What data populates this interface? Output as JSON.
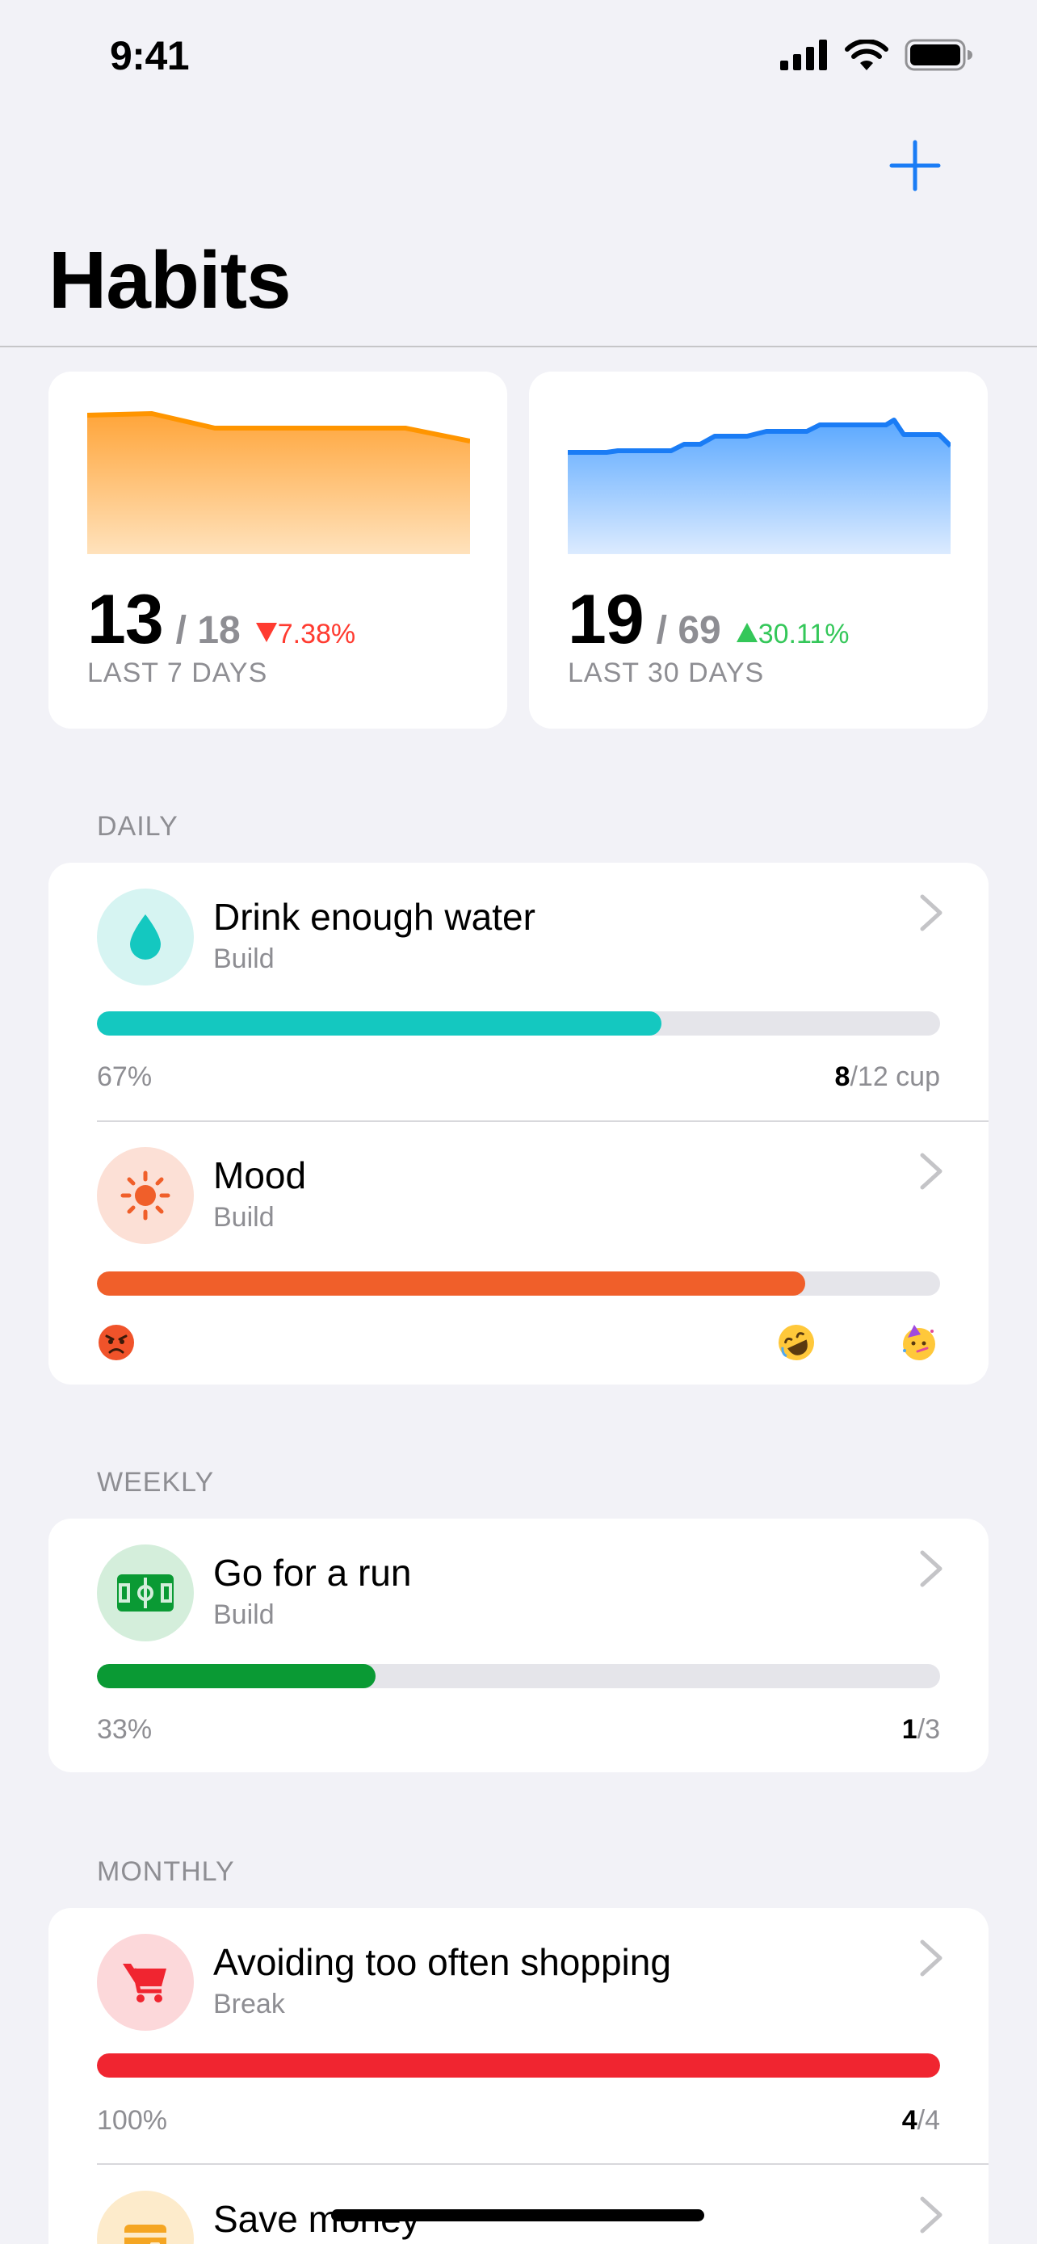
{
  "status_bar": {
    "time": "9:41"
  },
  "nav": {
    "title": "Habits"
  },
  "stats": [
    {
      "value": "13",
      "total": "/ 18",
      "change": "7.38%",
      "direction": "down",
      "label": "LAST 7 DAYS",
      "color": "#FF9500"
    },
    {
      "value": "19",
      "total": "/ 69",
      "change": "30.11%",
      "direction": "up",
      "label": "LAST 30 DAYS",
      "color": "#1A7CF5"
    }
  ],
  "sections": {
    "daily": {
      "header": "DAILY",
      "habits": [
        {
          "name": "Drink enough water",
          "type": "Build",
          "percent": "67%",
          "progress": 0.67,
          "count_done": "8",
          "count_rest": "/12 cup",
          "color": "#14C8C0",
          "icon": "water-drop-icon"
        },
        {
          "name": "Mood",
          "type": "Build",
          "progress": 0.84,
          "color": "#F05F2A",
          "icon": "sun-icon",
          "emojis": [
            "angry-face-emoji",
            "rolling-laughing-face-emoji",
            "partying-face-emoji"
          ]
        }
      ]
    },
    "weekly": {
      "header": "WEEKLY",
      "habits": [
        {
          "name": "Go for a run",
          "type": "Build",
          "percent": "33%",
          "progress": 0.33,
          "count_done": "1",
          "count_rest": "/3",
          "color": "#0A9A34",
          "icon": "field-icon"
        }
      ]
    },
    "monthly": {
      "header": "MONTHLY",
      "habits": [
        {
          "name": "Avoiding too often shopping",
          "type": "Break",
          "percent": "100%",
          "progress": 1.0,
          "count_done": "4",
          "count_rest": "/4",
          "color": "#F02530",
          "icon": "shopping-cart-icon"
        },
        {
          "name": "Save money",
          "color": "#F5A623",
          "icon": "wallet-icon"
        }
      ]
    }
  }
}
